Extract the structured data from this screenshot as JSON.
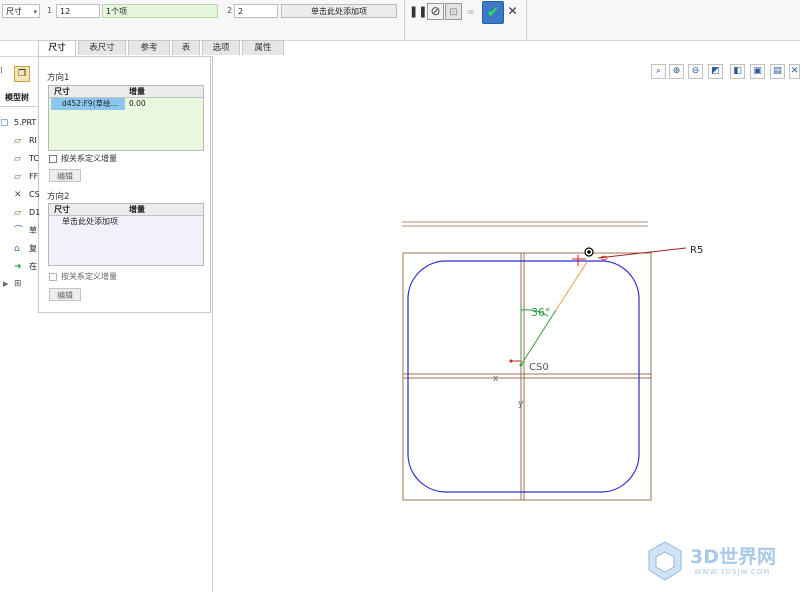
{
  "dashboard": {
    "type_select": "尺寸",
    "dir1_index": "1",
    "dir1_count": "12",
    "dir1_ref": "1个项",
    "dir2_index": "2",
    "dir2_count": "2",
    "dir2_ref": "单击此处添加项"
  },
  "tabs": [
    {
      "label": "尺寸"
    },
    {
      "label": "表尺寸"
    },
    {
      "label": "参考"
    },
    {
      "label": "表"
    },
    {
      "label": "选项"
    },
    {
      "label": "属性"
    }
  ],
  "panel": {
    "dir1_title": "方向1",
    "col_dim": "尺寸",
    "col_inc": "增量",
    "dir1_row_dim": "d452:F9(草绘...",
    "dir1_row_inc": "0.00",
    "relation_label": "按关系定义增量",
    "edit_label": "编辑",
    "dir2_title": "方向2",
    "dir2_row_dim": "单击此处添加项"
  },
  "model_tree": {
    "header": "模型树",
    "items": [
      {
        "label": "5.PRT"
      },
      {
        "label": "RI"
      },
      {
        "label": "TC"
      },
      {
        "label": "FF"
      },
      {
        "label": "CS"
      },
      {
        "label": "D1"
      },
      {
        "label": "草"
      },
      {
        "label": "复"
      },
      {
        "label": "在"
      }
    ]
  },
  "sketch": {
    "radius_label": "R5",
    "angle_label": "36°",
    "csys_label": "CS0",
    "x_label": "x",
    "y_label": "y"
  },
  "watermark": {
    "brand": "3D世界网",
    "url": "WWW.3DSJW.COM"
  },
  "colors": {
    "accent_green": "#2e9e3c",
    "sketch_blue": "#2a2acc",
    "reference_brown": "#a07050"
  }
}
